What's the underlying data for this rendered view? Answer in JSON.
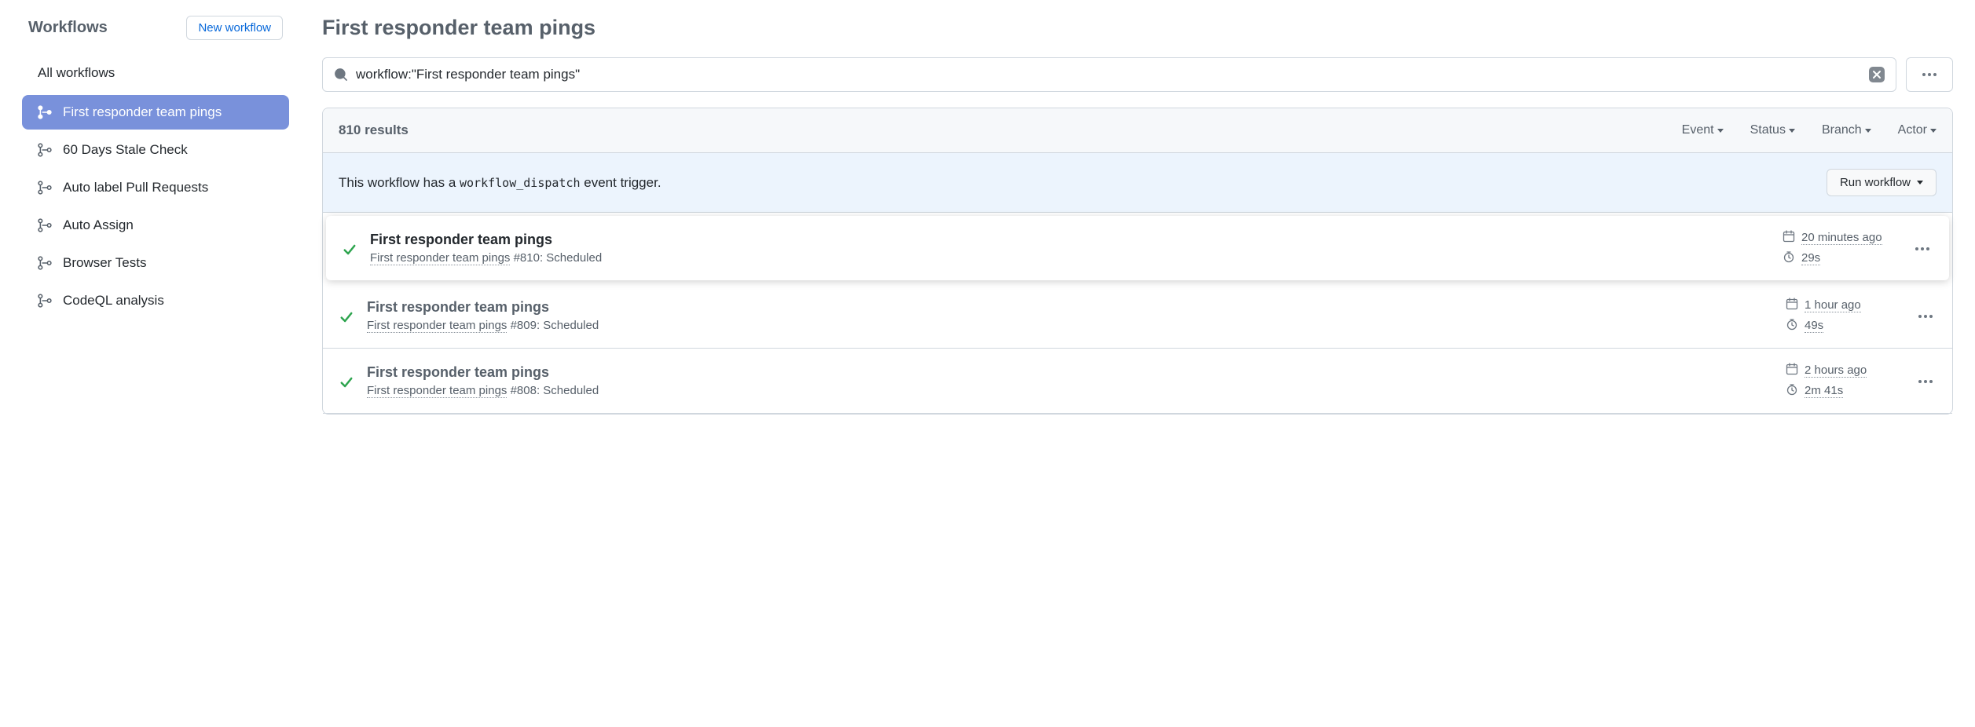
{
  "sidebar": {
    "title": "Workflows",
    "new_button": "New workflow",
    "all_label": "All workflows",
    "items": [
      {
        "label": "First responder team pings",
        "active": true
      },
      {
        "label": "60 Days Stale Check",
        "active": false
      },
      {
        "label": "Auto label Pull Requests",
        "active": false
      },
      {
        "label": "Auto Assign",
        "active": false
      },
      {
        "label": "Browser Tests",
        "active": false
      },
      {
        "label": "CodeQL analysis",
        "active": false
      }
    ]
  },
  "page": {
    "title": "First responder team pings"
  },
  "search": {
    "value": "workflow:\"First responder team pings\""
  },
  "results": {
    "count_label": "810 results",
    "filters": [
      "Event",
      "Status",
      "Branch",
      "Actor"
    ]
  },
  "dispatch": {
    "text_before": "This workflow has a ",
    "code": "workflow_dispatch",
    "text_after": " event trigger.",
    "button": "Run workflow"
  },
  "runs": [
    {
      "title": "First responder team pings",
      "workflow": "First responder team pings",
      "run_id": "#810",
      "trigger": "Scheduled",
      "time": "20 minutes ago",
      "duration": "29s",
      "highlighted": true
    },
    {
      "title": "First responder team pings",
      "workflow": "First responder team pings",
      "run_id": "#809",
      "trigger": "Scheduled",
      "time": "1 hour ago",
      "duration": "49s",
      "highlighted": false
    },
    {
      "title": "First responder team pings",
      "workflow": "First responder team pings",
      "run_id": "#808",
      "trigger": "Scheduled",
      "time": "2 hours ago",
      "duration": "2m 41s",
      "highlighted": false
    }
  ]
}
